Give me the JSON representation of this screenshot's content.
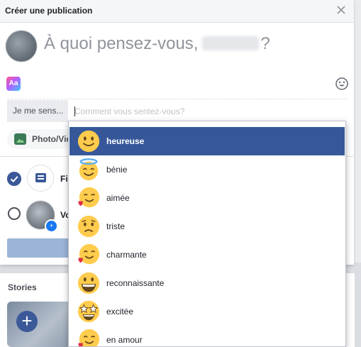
{
  "modal": {
    "title": "Créer une publication",
    "prompt": "À quoi pensez-vous,",
    "prompt_suffix": "?"
  },
  "feeling": {
    "label": "Je me sens...",
    "placeholder": "Comment vous sentez-vous?"
  },
  "actions": {
    "photo_label": "Photo/Vid"
  },
  "audience": {
    "feed_label": "Fi",
    "story_label": "Vo"
  },
  "feed": {
    "stories_title": "Stories",
    "add_symbol": "+"
  },
  "options": [
    {
      "label": "heureuse",
      "icon": "smiling-face-icon",
      "selected": true
    },
    {
      "label": "bénie",
      "icon": "halo-face-icon",
      "selected": false
    },
    {
      "label": "aimée",
      "icon": "heart-smile-face-icon",
      "selected": false
    },
    {
      "label": "triste",
      "icon": "sad-face-icon",
      "selected": false
    },
    {
      "label": "charmante",
      "icon": "heart-smile-face-icon",
      "selected": false
    },
    {
      "label": "reconnaissante",
      "icon": "grinning-face-icon",
      "selected": false
    },
    {
      "label": "excitée",
      "icon": "star-eyes-face-icon",
      "selected": false
    },
    {
      "label": "en amour",
      "icon": "heart-smile-face-icon",
      "selected": false
    }
  ],
  "colors": {
    "accent": "#365899",
    "emoji_yellow": "#ffcc4d"
  }
}
